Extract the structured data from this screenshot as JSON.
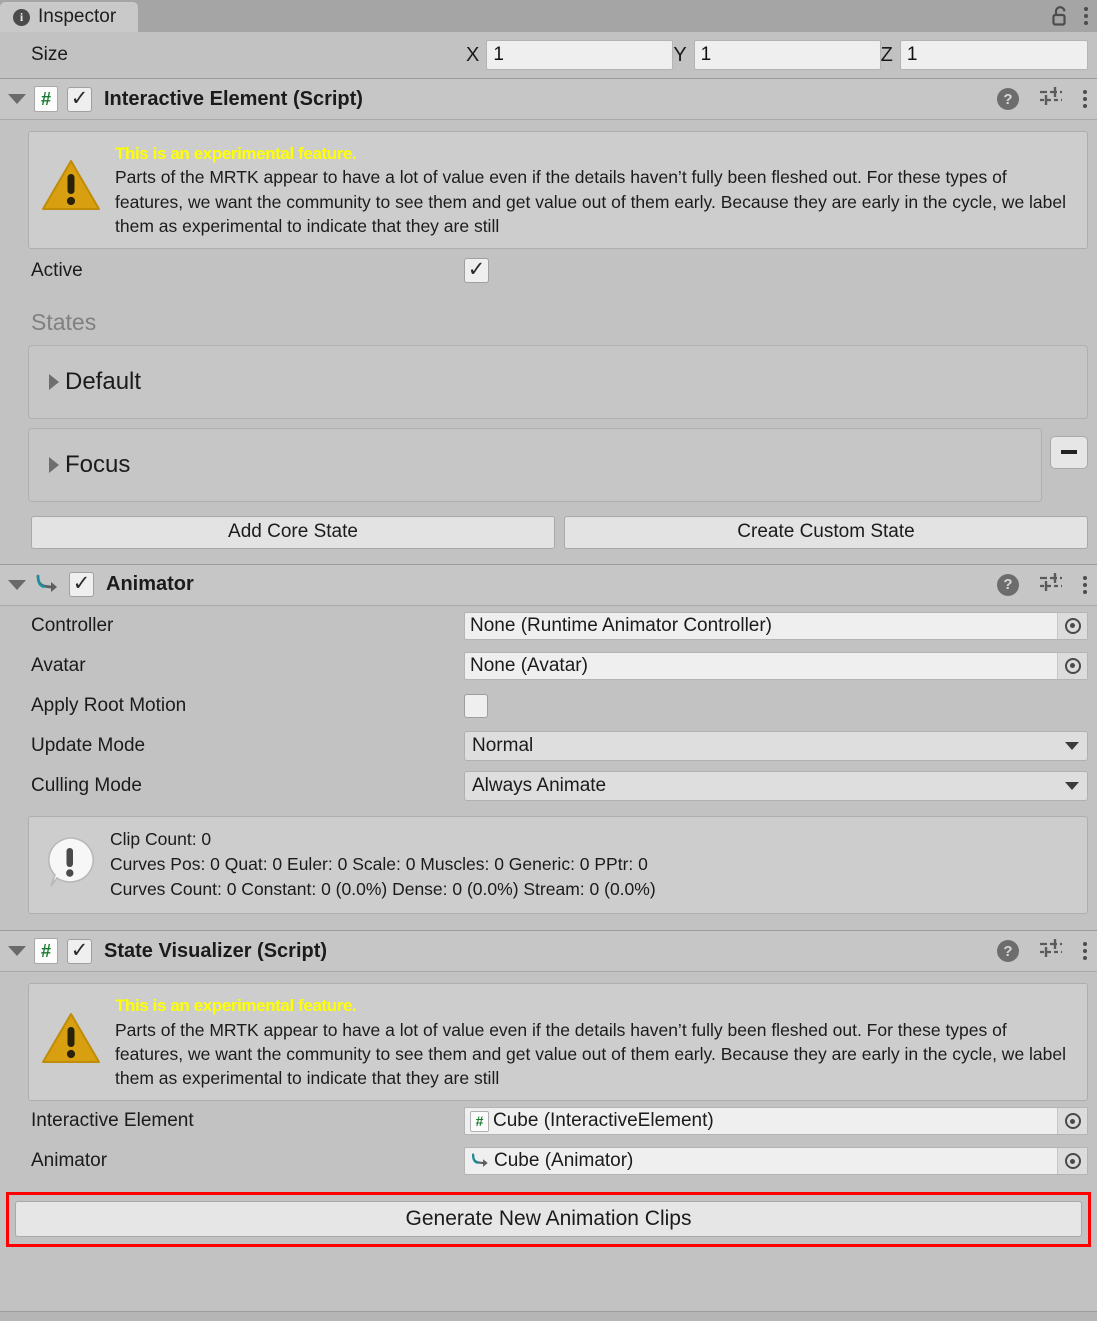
{
  "window": {
    "tab_label": "Inspector",
    "tab_icon": "info-icon",
    "lock_icon": "unlocked-padlock-icon",
    "menu_icon": "kebab-menu-icon"
  },
  "size_row": {
    "label": "Size",
    "axes": [
      {
        "name": "X",
        "value": "1"
      },
      {
        "name": "Y",
        "value": "1"
      },
      {
        "name": "Z",
        "value": "1"
      }
    ]
  },
  "experimental_warning": {
    "title": "This is an experimental feature.",
    "body": "Parts of the MRTK appear to have a lot of value even if the details haven’t fully been fleshed out. For these types of features, we want the community to see them and get value out of them early. Because they are early in the cycle, we label them as experimental to indicate that they are still"
  },
  "interactive_element": {
    "title": "Interactive Element (Script)",
    "enabled": true,
    "expanded": true,
    "active_label": "Active",
    "active_checked": true,
    "states_label": "States",
    "states": [
      {
        "name": "Default",
        "expanded": false,
        "removable": false
      },
      {
        "name": "Focus",
        "expanded": false,
        "removable": true
      }
    ],
    "add_core_state_label": "Add Core State",
    "create_custom_state_label": "Create Custom State",
    "remove_label": "−"
  },
  "animator": {
    "title": "Animator",
    "enabled": true,
    "expanded": true,
    "fields": [
      {
        "label": "Controller",
        "type": "object",
        "value": "None (Runtime Animator Controller)"
      },
      {
        "label": "Avatar",
        "type": "object",
        "value": "None (Avatar)"
      },
      {
        "label": "Apply Root Motion",
        "type": "checkbox",
        "checked": false
      },
      {
        "label": "Update Mode",
        "type": "dropdown",
        "value": "Normal"
      },
      {
        "label": "Culling Mode",
        "type": "dropdown",
        "value": "Always Animate"
      }
    ],
    "info": {
      "line1": "Clip Count: 0",
      "line2": "Curves Pos: 0 Quat: 0 Euler: 0 Scale: 0 Muscles: 0 Generic: 0 PPtr: 0",
      "line3": "Curves Count: 0 Constant: 0 (0.0%) Dense: 0 (0.0%) Stream: 0 (0.0%)"
    }
  },
  "state_visualizer": {
    "title": "State Visualizer (Script)",
    "enabled": true,
    "expanded": true,
    "fields": [
      {
        "label": "Interactive Element",
        "value": "Cube (InteractiveElement)",
        "icon": "script-icon"
      },
      {
        "label": "Animator",
        "value": "Cube (Animator)",
        "icon": "animator-icon"
      }
    ],
    "generate_button_label": "Generate New Animation Clips",
    "highlight_color": "#ff0000"
  },
  "colors": {
    "window_bg": "#c2c2c2",
    "header_bg": "#c6c6c6",
    "field_bg": "#efefef",
    "warning_yellow": "#ffff00",
    "triangle_gold": "#d8a010",
    "script_green": "#197b30",
    "animator_teal": "#1a8fa0",
    "highlight_red": "#ff0000"
  }
}
